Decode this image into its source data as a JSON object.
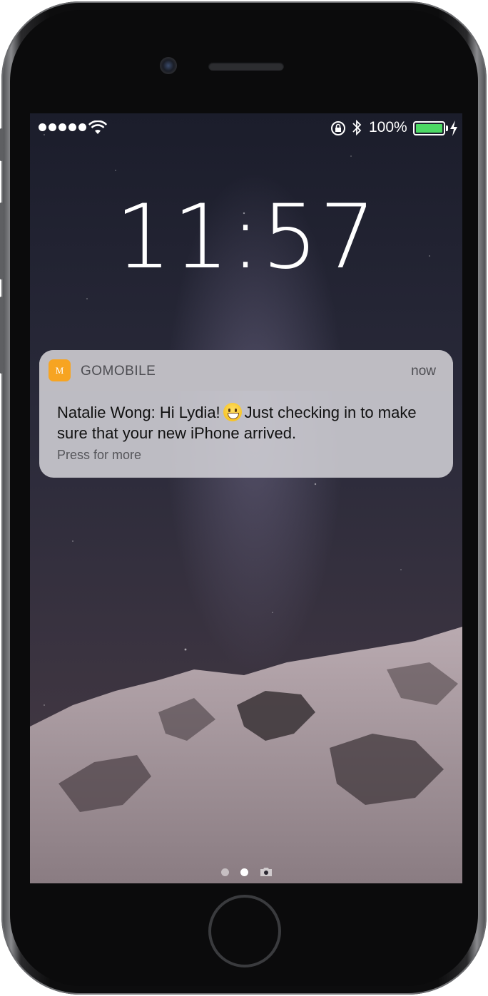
{
  "status_bar": {
    "signal_dots": 5,
    "battery_percent_label": "100%",
    "battery_level": 1.0,
    "battery_color": "#4cd964",
    "icons": [
      "wifi-icon",
      "rotation-lock-icon",
      "bluetooth-icon",
      "battery-icon",
      "charging-bolt-icon"
    ]
  },
  "lock_screen": {
    "time": "11:57"
  },
  "notification": {
    "app_name": "GOMOBILE",
    "app_icon_letter": "M",
    "app_icon_color": "#f7a421",
    "time": "now",
    "message_before_emoji": "Natalie Wong: Hi Lydia!",
    "emoji": "grinning-face-icon",
    "message_after_emoji": "Just checking in to make sure that your new iPhone arrived.",
    "action_hint": "Press for more"
  },
  "page_indicator": {
    "pages": 2,
    "active_index": 1,
    "extra_icon": "camera-icon"
  }
}
